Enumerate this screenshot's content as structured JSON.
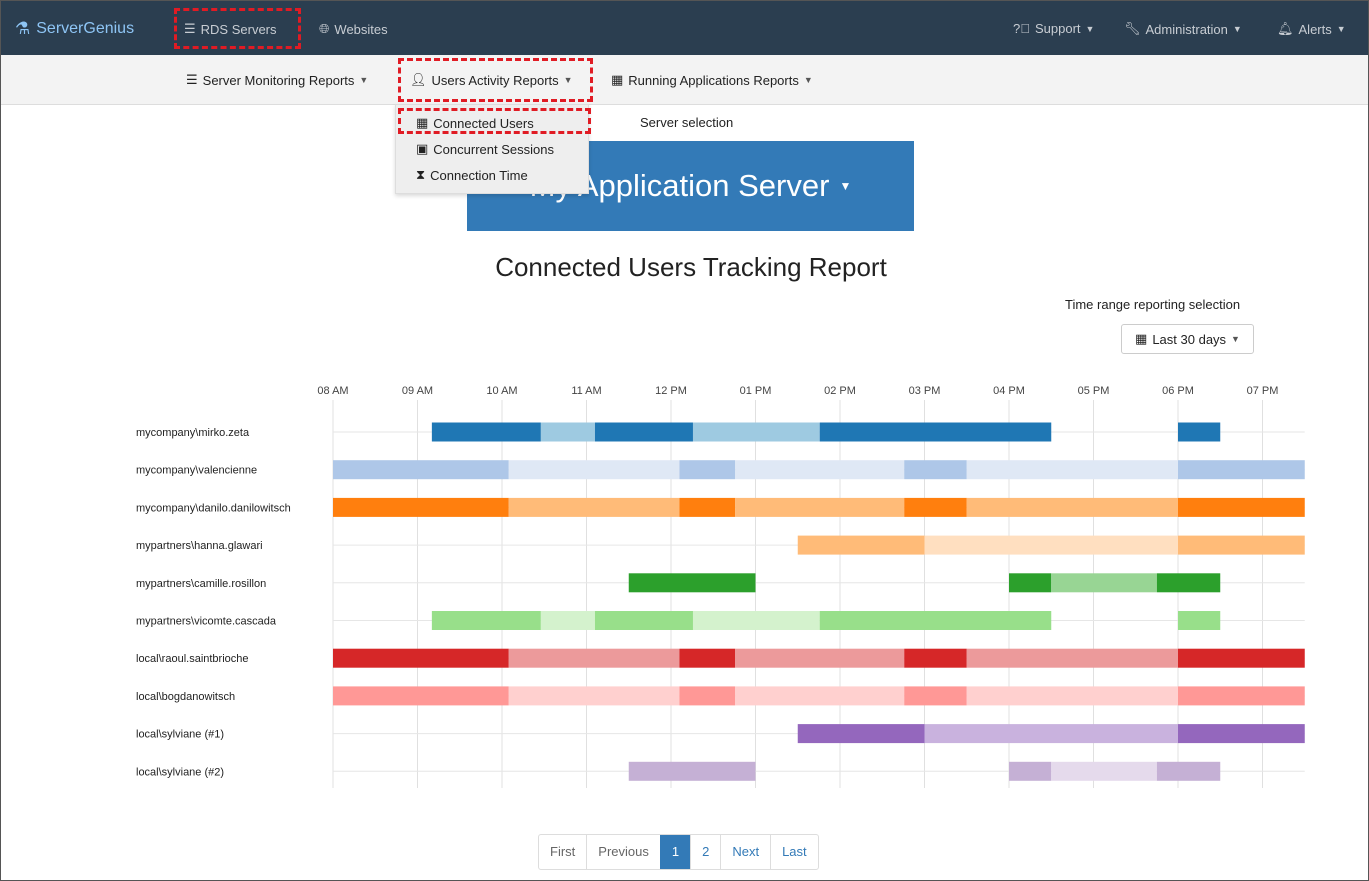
{
  "app": {
    "brand": "ServerGenius",
    "top_nav": {
      "rds_servers": "RDS Servers",
      "websites": "Websites",
      "support": "Support",
      "administration": "Administration",
      "alerts": "Alerts"
    }
  },
  "subnav": {
    "server_monitoring": "Server Monitoring Reports",
    "users_activity": "Users Activity Reports",
    "running_apps": "Running Applications Reports"
  },
  "dropdown": {
    "items": [
      "Connected Users",
      "Concurrent Sessions",
      "Connection Time"
    ]
  },
  "server_selection": {
    "label": "Server selection",
    "selected": "My Application Server"
  },
  "report": {
    "title": "Connected Users Tracking Report",
    "range_label": "Time range reporting selection",
    "range_value": "Last 30 days"
  },
  "timeline": {
    "hours": [
      "08 AM",
      "09 AM",
      "10 AM",
      "11 AM",
      "12 PM",
      "01 PM",
      "02 PM",
      "03 PM",
      "04 PM",
      "05 PM",
      "06 PM",
      "07 PM"
    ],
    "range": [
      8.0,
      19.5
    ],
    "rows": [
      {
        "user": "mycompany\\mirko.zeta",
        "dark": "#1f77b4",
        "light": "#9ecae1",
        "segments": [
          [
            9.17,
            10.46,
            "d"
          ],
          [
            10.46,
            11.1,
            "l"
          ],
          [
            11.1,
            12.26,
            "d"
          ],
          [
            12.26,
            13.76,
            "l"
          ],
          [
            13.76,
            16.5,
            "d"
          ],
          [
            18.0,
            18.5,
            "d"
          ]
        ]
      },
      {
        "user": "mycompany\\valencienne",
        "dark": "#aec7e8",
        "light": "#dfe8f5",
        "segments": [
          [
            8.0,
            10.08,
            "d"
          ],
          [
            10.08,
            12.1,
            "l"
          ],
          [
            12.1,
            12.76,
            "d"
          ],
          [
            12.76,
            14.76,
            "l"
          ],
          [
            14.76,
            15.5,
            "d"
          ],
          [
            15.5,
            18.0,
            "l"
          ],
          [
            18.0,
            19.5,
            "d"
          ]
        ]
      },
      {
        "user": "mycompany\\danilo.danilowitsch",
        "dark": "#ff7f0e",
        "light": "#ffbb78",
        "segments": [
          [
            8.0,
            10.08,
            "d"
          ],
          [
            10.08,
            12.1,
            "l"
          ],
          [
            12.1,
            12.76,
            "d"
          ],
          [
            12.76,
            14.76,
            "l"
          ],
          [
            14.76,
            15.5,
            "d"
          ],
          [
            15.5,
            18.0,
            "l"
          ],
          [
            18.0,
            19.5,
            "d"
          ]
        ]
      },
      {
        "user": "mypartners\\hanna.glawari",
        "dark": "#ffbb78",
        "light": "#ffdfc0",
        "segments": [
          [
            13.5,
            15.0,
            "d"
          ],
          [
            15.0,
            18.0,
            "l"
          ],
          [
            18.0,
            19.5,
            "d"
          ]
        ]
      },
      {
        "user": "mypartners\\camille.rosillon",
        "dark": "#2ca02c",
        "light": "#98d594",
        "segments": [
          [
            11.5,
            13.0,
            "d"
          ],
          [
            16.0,
            16.5,
            "d"
          ],
          [
            16.5,
            17.75,
            "l"
          ],
          [
            17.75,
            18.5,
            "d"
          ]
        ]
      },
      {
        "user": "mypartners\\vicomte.cascada",
        "dark": "#98df8a",
        "light": "#d4f2cd",
        "segments": [
          [
            9.17,
            10.46,
            "d"
          ],
          [
            10.46,
            11.1,
            "l"
          ],
          [
            11.1,
            12.26,
            "d"
          ],
          [
            12.26,
            13.76,
            "l"
          ],
          [
            13.76,
            16.5,
            "d"
          ],
          [
            18.0,
            18.5,
            "d"
          ]
        ]
      },
      {
        "user": "local\\raoul.saintbrioche",
        "dark": "#d62728",
        "light": "#ec9a9b",
        "segments": [
          [
            8.0,
            10.08,
            "d"
          ],
          [
            10.08,
            12.1,
            "l"
          ],
          [
            12.1,
            12.76,
            "d"
          ],
          [
            12.76,
            14.76,
            "l"
          ],
          [
            14.76,
            15.5,
            "d"
          ],
          [
            15.5,
            18.0,
            "l"
          ],
          [
            18.0,
            19.5,
            "d"
          ]
        ]
      },
      {
        "user": "local\\bogdanowitsch",
        "dark": "#ff9896",
        "light": "#ffd0cf",
        "segments": [
          [
            8.0,
            10.08,
            "d"
          ],
          [
            10.08,
            12.1,
            "l"
          ],
          [
            12.1,
            12.76,
            "d"
          ],
          [
            12.76,
            14.76,
            "l"
          ],
          [
            14.76,
            15.5,
            "d"
          ],
          [
            15.5,
            18.0,
            "l"
          ],
          [
            18.0,
            19.5,
            "d"
          ]
        ]
      },
      {
        "user": "local\\sylviane (#1)",
        "dark": "#9467bd",
        "light": "#c9b2de",
        "segments": [
          [
            13.5,
            15.0,
            "d"
          ],
          [
            15.0,
            18.0,
            "l"
          ],
          [
            18.0,
            19.5,
            "d"
          ]
        ]
      },
      {
        "user": "local\\sylviane (#2)",
        "dark": "#c5b0d5",
        "light": "#e5daec",
        "segments": [
          [
            11.5,
            13.0,
            "d"
          ],
          [
            16.0,
            16.5,
            "d"
          ],
          [
            16.5,
            17.75,
            "l"
          ],
          [
            17.75,
            18.5,
            "d"
          ]
        ]
      }
    ]
  },
  "pagination": {
    "first": "First",
    "previous": "Previous",
    "page1": "1",
    "page2": "2",
    "next": "Next",
    "last": "Last"
  }
}
